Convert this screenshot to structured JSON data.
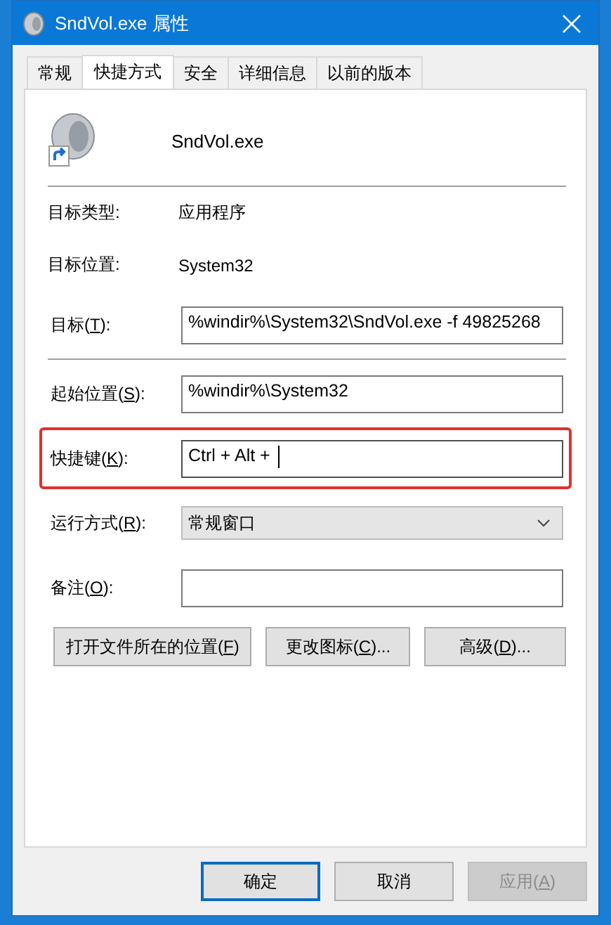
{
  "window": {
    "title": "SndVol.exe 属性"
  },
  "tabs": [
    {
      "label": "常规",
      "selected": false
    },
    {
      "label": "快捷方式",
      "selected": true
    },
    {
      "label": "安全",
      "selected": false
    },
    {
      "label": "详细信息",
      "selected": false
    },
    {
      "label": "以前的版本",
      "selected": false
    }
  ],
  "header": {
    "name": "SndVol.exe"
  },
  "info": [
    {
      "label": "目标类型:",
      "value": "应用程序"
    },
    {
      "label": "目标位置:",
      "value": "System32"
    }
  ],
  "target_rows": [
    {
      "kind": "text",
      "label": [
        "目标(",
        "T",
        "):"
      ],
      "value": "%windir%\\System32\\SndVol.exe -f 49825268",
      "focused": false
    }
  ],
  "rows": [
    {
      "kind": "text",
      "label": [
        "起始位置(",
        "S",
        "):"
      ],
      "value": "%windir%\\System32",
      "focused": false
    },
    {
      "kind": "text",
      "label": [
        "快捷键(",
        "K",
        "):"
      ],
      "value": "Ctrl + Alt +",
      "highlighted": true,
      "focused": true
    },
    {
      "kind": "dropdown",
      "label": [
        "运行方式(",
        "R",
        "):"
      ],
      "value": "常规窗口",
      "focused": false
    },
    {
      "kind": "text",
      "label": [
        "备注(",
        "O",
        "):"
      ],
      "focused": false
    }
  ],
  "actions": [
    {
      "label": [
        "打开文件所在的位置(",
        "F",
        ")"
      ]
    },
    {
      "label": [
        "更改图标(",
        "C",
        ")..."
      ]
    },
    {
      "label": [
        "高级(",
        "D",
        ")..."
      ]
    }
  ],
  "footer_buttons": [
    {
      "label": [
        "确定"
      ],
      "default": true,
      "disabled": false
    },
    {
      "label": [
        "取消"
      ],
      "default": false,
      "disabled": false
    },
    {
      "label": [
        "应用(",
        "A",
        ")"
      ],
      "default": false,
      "disabled": true
    }
  ]
}
